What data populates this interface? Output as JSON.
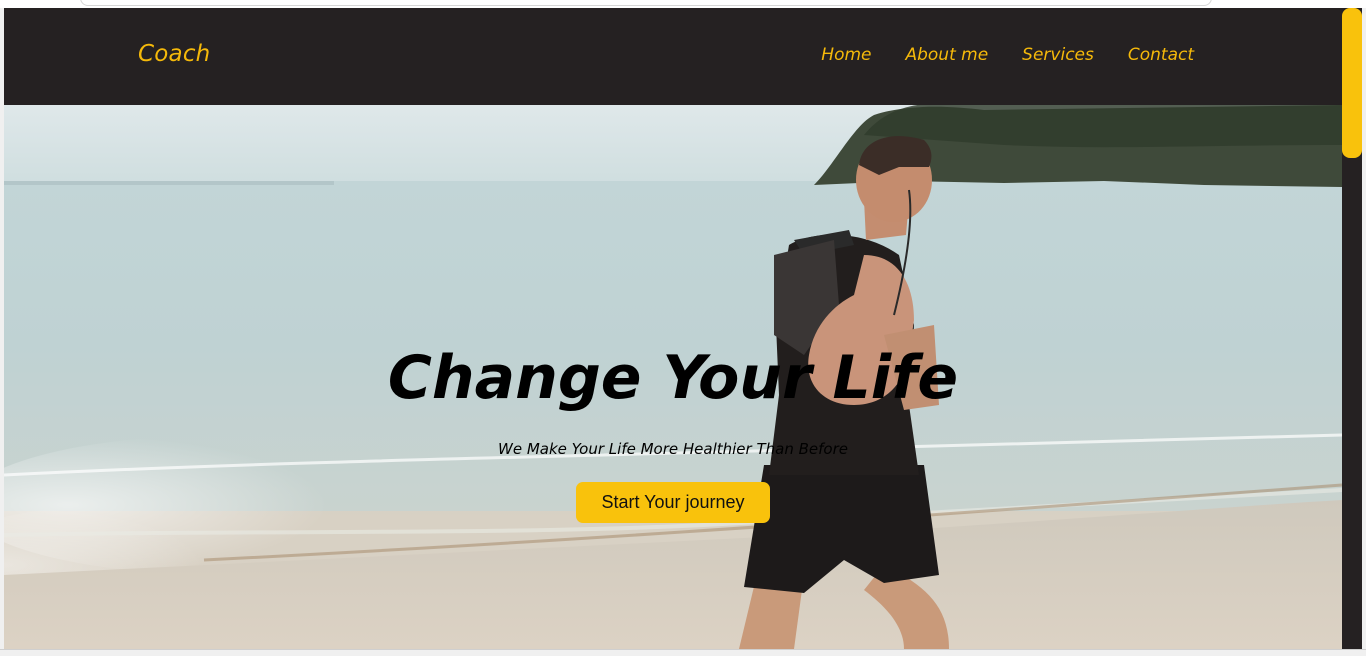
{
  "header": {
    "logo": "Coach",
    "nav": [
      {
        "label": "Home"
      },
      {
        "label": "About me"
      },
      {
        "label": "Services"
      },
      {
        "label": "Contact"
      }
    ]
  },
  "hero": {
    "title": "Change Your Life",
    "subtitle": "We Make Your Life More Healthier Than Before",
    "cta_label": "Start Your journey",
    "background_scene": "runner-on-beach-photo"
  },
  "colors": {
    "accent": "#f9c20c",
    "header_bg": "#252122",
    "text_dark": "#000000"
  }
}
